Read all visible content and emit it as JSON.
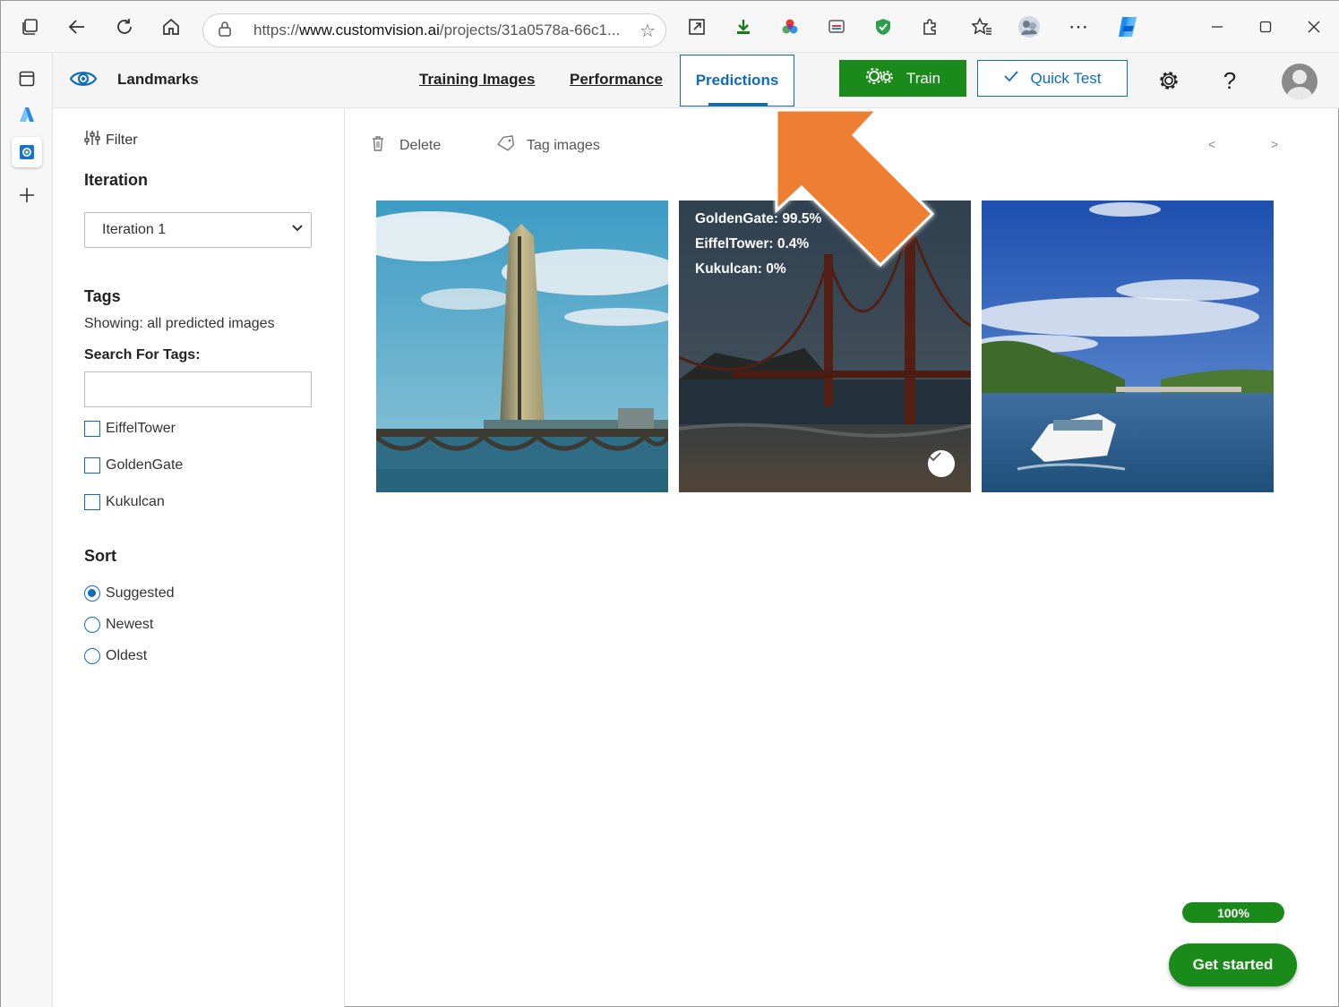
{
  "browser": {
    "url_prefix": "https://",
    "url_host": "www.customvision.ai",
    "url_path": "/projects/31a0578a-66c1...",
    "icons": [
      "tab-actions-icon",
      "back-icon",
      "refresh-icon",
      "home-icon",
      "lock-icon",
      "favorite-star-icon",
      "open-window-icon",
      "download-extension-icon",
      "color-wheel-icon",
      "cast-icon",
      "shield-icon",
      "extensions-icon",
      "favorites-icon",
      "profile-icon",
      "more-icon",
      "copilot-icon",
      "minimize-icon",
      "maximize-icon",
      "close-icon"
    ]
  },
  "app": {
    "project_name": "Landmarks",
    "tabs": [
      {
        "label": "Training Images",
        "active": false
      },
      {
        "label": "Performance",
        "active": false
      },
      {
        "label": "Predictions",
        "active": true
      }
    ],
    "train_label": "Train",
    "quick_test_label": "Quick Test",
    "help_glyph": "?",
    "accent_color": "#0f6cbd",
    "train_color": "#1a8a1a"
  },
  "filter_panel": {
    "filter_label": "Filter",
    "iteration_heading": "Iteration",
    "iteration_selected": "Iteration 1",
    "tags_heading": "Tags",
    "showing_text": "Showing: all predicted images",
    "search_label": "Search For Tags:",
    "search_value": "",
    "tags": [
      {
        "label": "EiffelTower",
        "checked": false
      },
      {
        "label": "GoldenGate",
        "checked": false
      },
      {
        "label": "Kukulcan",
        "checked": false
      }
    ],
    "sort_heading": "Sort",
    "sort_options": [
      {
        "label": "Suggested",
        "selected": true
      },
      {
        "label": "Newest",
        "selected": false
      },
      {
        "label": "Oldest",
        "selected": false
      }
    ]
  },
  "toolbar": {
    "delete_label": "Delete",
    "tag_images_label": "Tag images",
    "prev_glyph": "<",
    "next_glyph": ">"
  },
  "images": [
    {
      "subject": "skyscraper-by-river"
    },
    {
      "subject": "golden-gate-bridge",
      "predictions": [
        "GoldenGate: 99.5%",
        "EiffelTower: 0.4%",
        "Kukulcan: 0%"
      ],
      "selected": true
    },
    {
      "subject": "river-tour-boat"
    }
  ],
  "footer": {
    "progress_label": "100%",
    "progress_value": 1.0,
    "get_started_label": "Get started"
  }
}
